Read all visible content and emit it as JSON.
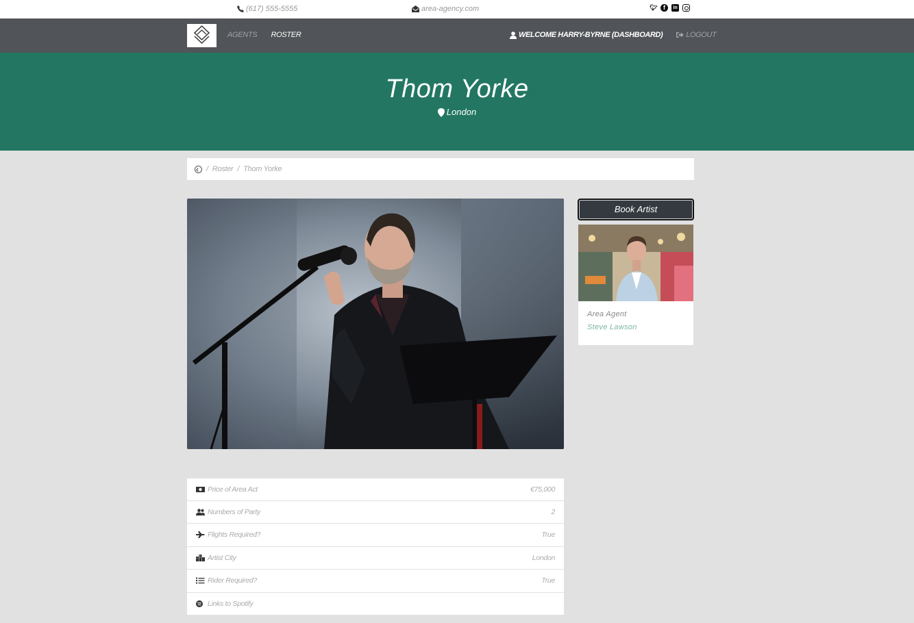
{
  "topbar": {
    "phone": "(617) 555-5555",
    "email": "area-agency.com",
    "social": [
      "twitter-icon",
      "facebook-icon",
      "linkedin-icon",
      "instagram-icon"
    ]
  },
  "nav": {
    "left": [
      "AGENTS",
      "ROSTER"
    ],
    "welcome": "WELCOME HARRY-BYRNE (DASHBOARD)",
    "logout": "LOGOUT"
  },
  "hero": {
    "name": "Thom Yorke",
    "location": "London"
  },
  "breadcrumb": {
    "sep1": "/",
    "roster": "Roster",
    "sep2": "/",
    "current": "Thom Yorke"
  },
  "sidebar": {
    "book_label": "Book Artist",
    "agent_role": "Area Agent",
    "agent_name": "Steve Lawson"
  },
  "details": [
    {
      "icon": "money-icon",
      "label": "Price of Area Act",
      "value": "€75,000"
    },
    {
      "icon": "users-icon",
      "label": "Numbers of Party",
      "value": "2"
    },
    {
      "icon": "plane-icon",
      "label": "Flights Required?",
      "value": "True"
    },
    {
      "icon": "city-icon",
      "label": "Artist City",
      "value": "London"
    },
    {
      "icon": "list-icon",
      "label": "Rider Required?",
      "value": "True"
    },
    {
      "icon": "spotify-icon",
      "label": "Links to Spotify",
      "value": ""
    }
  ],
  "colors": {
    "hero": "#237762",
    "navbar": "#515458",
    "background": "#e1e1e1",
    "button": "#343a40",
    "agent_link": "#7bb5a5"
  }
}
